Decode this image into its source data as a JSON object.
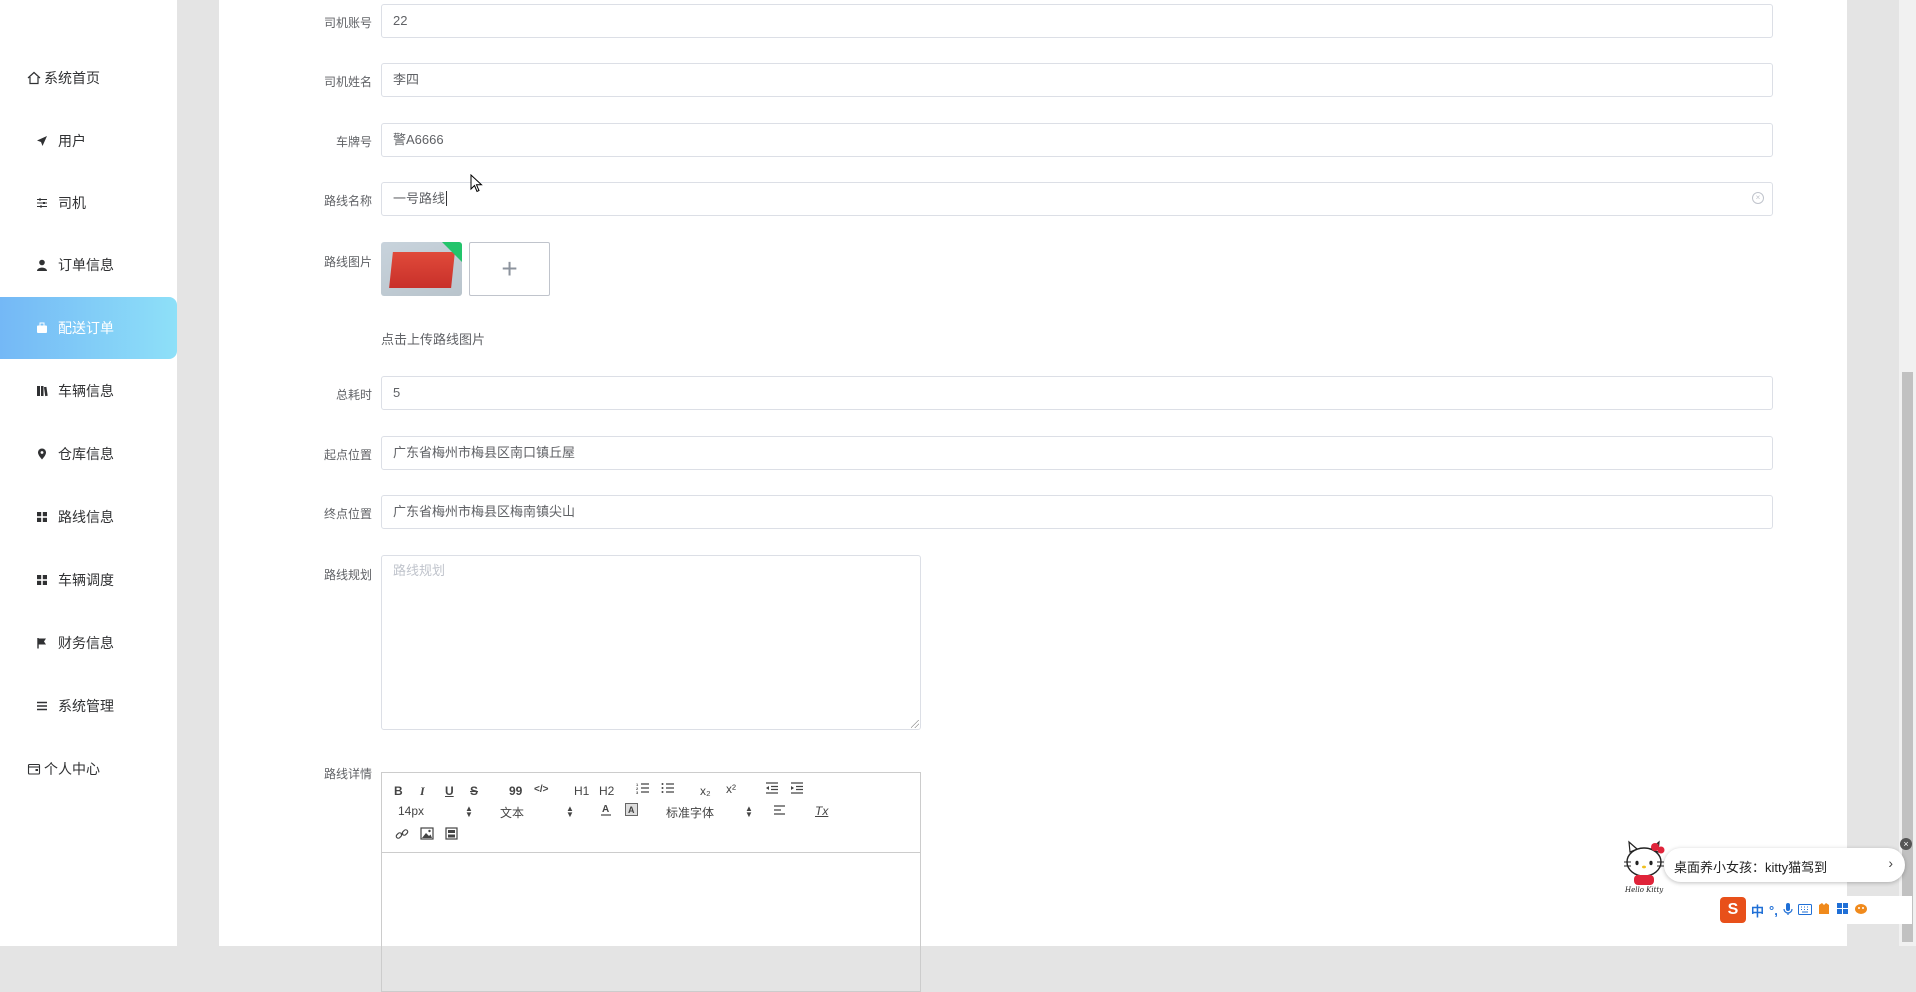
{
  "sidebar": {
    "items": [
      {
        "label": "系统首页",
        "icon": "home-icon"
      },
      {
        "label": "用户",
        "icon": "paper-plane-icon"
      },
      {
        "label": "司机",
        "icon": "sliders-icon"
      },
      {
        "label": "订单信息",
        "icon": "user-icon"
      },
      {
        "label": "配送订单",
        "icon": "briefcase-icon",
        "active": true
      },
      {
        "label": "车辆信息",
        "icon": "book-icon"
      },
      {
        "label": "仓库信息",
        "icon": "map-pin-icon"
      },
      {
        "label": "路线信息",
        "icon": "grid-icon"
      },
      {
        "label": "车辆调度",
        "icon": "grid-icon"
      },
      {
        "label": "财务信息",
        "icon": "flag-icon"
      },
      {
        "label": "系统管理",
        "icon": "list-icon"
      },
      {
        "label": "个人中心",
        "icon": "wallet-icon"
      }
    ]
  },
  "form": {
    "driver_account": {
      "label": "司机账号",
      "value": "22"
    },
    "driver_name": {
      "label": "司机姓名",
      "value": "李四"
    },
    "plate": {
      "label": "车牌号",
      "value": "警A6666"
    },
    "route_name": {
      "label": "路线名称",
      "value": "一号路线"
    },
    "route_image": {
      "label": "路线图片",
      "hint": "点击上传路线图片",
      "add_symbol": "+"
    },
    "total_time": {
      "label": "总耗时",
      "value": "5"
    },
    "start": {
      "label": "起点位置",
      "value": "广东省梅州市梅县区南口镇丘屋"
    },
    "end": {
      "label": "终点位置",
      "value": "广东省梅州市梅县区梅南镇尖山"
    },
    "plan": {
      "label": "路线规划",
      "placeholder": "路线规划"
    },
    "detail": {
      "label": "路线详情"
    }
  },
  "editor": {
    "bold": "B",
    "italic": "I",
    "underline": "U",
    "strike": "S",
    "quote": "99",
    "code": "</>",
    "h1": "H1",
    "h2": "H2",
    "sub": "x₂",
    "sup": "x²",
    "size": "14px",
    "header": "文本",
    "font": "标准字体",
    "clean": "Tx"
  },
  "ime": {
    "notice": "桌面养小女孩：kitty猫驾到",
    "zh": "中",
    "punct": "°,",
    "logo": "S"
  }
}
